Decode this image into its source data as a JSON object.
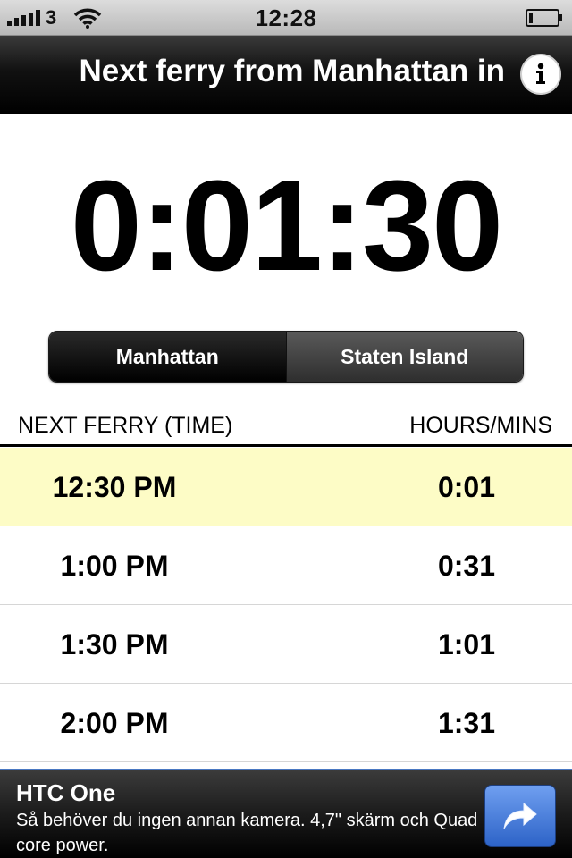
{
  "status_bar": {
    "carrier": "3",
    "time": "12:28"
  },
  "nav": {
    "title": "Next ferry from Manhattan in",
    "info_icon": "info-icon"
  },
  "countdown": "0:01:30",
  "segments": [
    {
      "label": "Manhattan",
      "selected": true
    },
    {
      "label": "Staten Island",
      "selected": false
    }
  ],
  "table": {
    "col_time": "NEXT FERRY (TIME)",
    "col_remaining": "HOURS/MINS",
    "rows": [
      {
        "time": "12:30 PM",
        "remaining": "0:01",
        "highlight": true
      },
      {
        "time": "1:00 PM",
        "remaining": "0:31",
        "highlight": false
      },
      {
        "time": "1:30 PM",
        "remaining": "1:01",
        "highlight": false
      },
      {
        "time": "2:00 PM",
        "remaining": "1:31",
        "highlight": false
      }
    ]
  },
  "ad": {
    "title": "HTC One",
    "text": "Så behöver du ingen annan kamera. 4,7\" skärm och Quad core power.",
    "action_icon": "share-arrow-icon"
  },
  "colors": {
    "highlight_row": "#fdfcc6",
    "ad_button": "#3f72d6"
  }
}
